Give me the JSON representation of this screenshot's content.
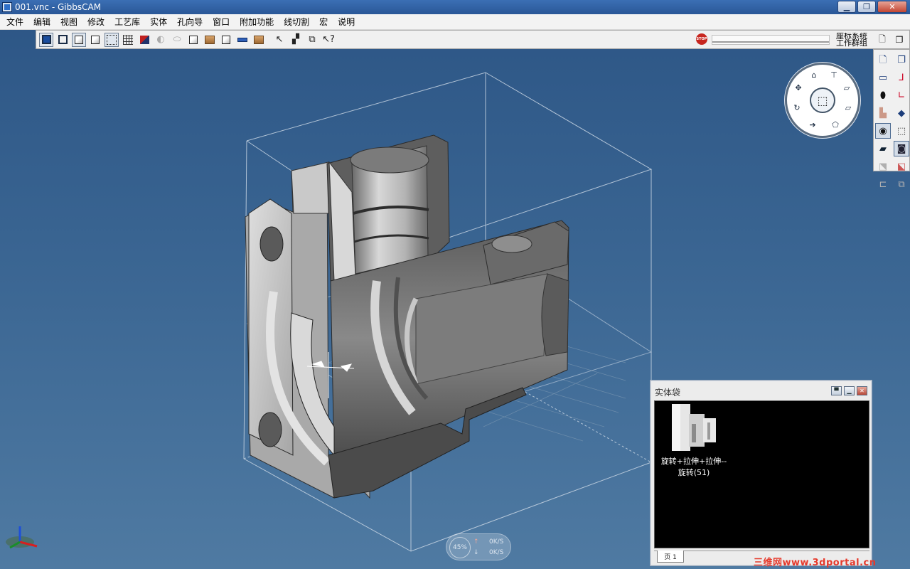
{
  "window": {
    "title": "001.vnc - GibbsCAM",
    "minimize": "▁",
    "restore": "❐",
    "close": "✕"
  },
  "menu": [
    "文件",
    "编辑",
    "视图",
    "修改",
    "工艺库",
    "实体",
    "孔向导",
    "窗口",
    "附加功能",
    "线切割",
    "宏",
    "说明"
  ],
  "toolbar": {
    "stop_label": "STOP",
    "coord_label_1": "座标系统",
    "coord_label_2": "工作群组"
  },
  "solid_bag": {
    "title": "实体袋",
    "item_label_line1": "旋转+拉伸+拉伸--",
    "item_label_line2": "旋转(51)",
    "tab_label": "页 1"
  },
  "network": {
    "percent": "45%",
    "up_rate": "0K/S",
    "down_rate": "0K/S"
  },
  "watermark": "三维网www.3dportal.cn",
  "colors": {
    "viewport_top": "#2c5585",
    "viewport_bottom": "#4f7aa2",
    "part": "#6b6b6b",
    "part_light": "#bdbdbd",
    "accent_red": "#e63a2c"
  }
}
